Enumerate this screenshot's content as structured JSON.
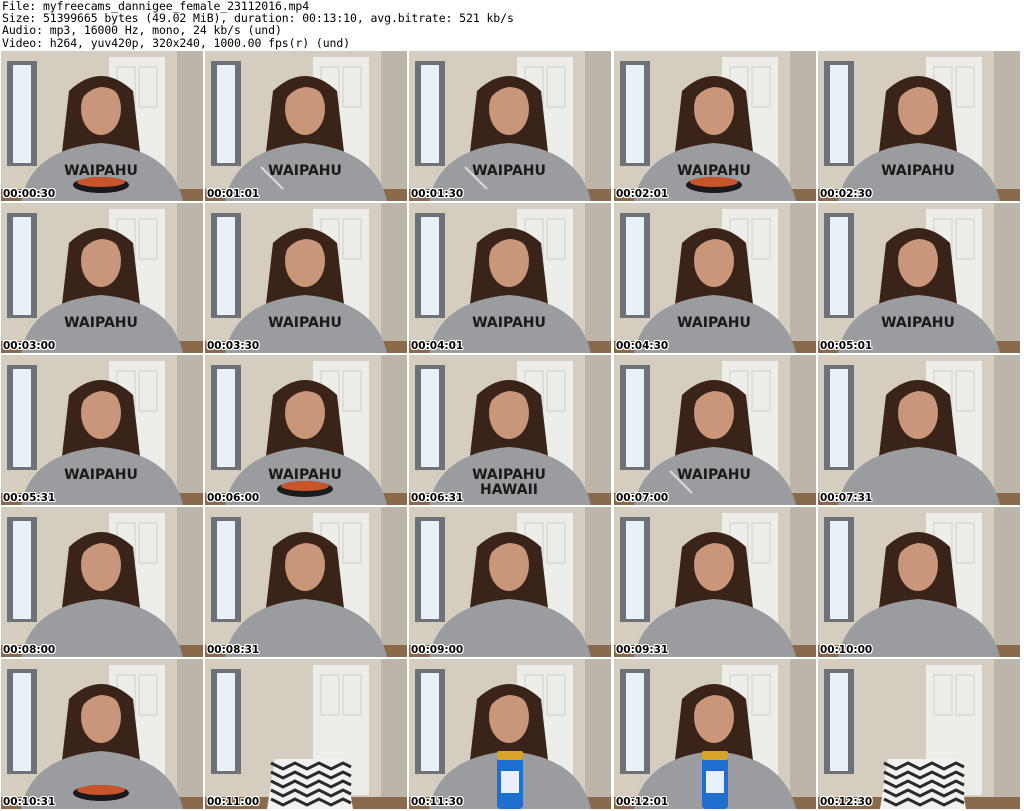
{
  "header": {
    "file_line": "File: myfreecams_dannigee_female_23112016.mp4",
    "size_line": "Size: 51399665 bytes (49.02 MiB), duration: 00:13:10, avg.bitrate: 521 kb/s",
    "audio_line": "Audio: mp3, 16000 Hz, mono, 24 kb/s (und)",
    "video_line": "Video: h264, yuv420p, 320x240, 1000.00 fps(r) (und)"
  },
  "grid": {
    "columns": 5,
    "rows": 5
  },
  "thumbnails": [
    {
      "timestamp": "00:00:30",
      "scene": "person",
      "hoodie": "WAIPAHU",
      "prop": "bowl"
    },
    {
      "timestamp": "00:01:01",
      "scene": "person",
      "hoodie": "WAIPAHU",
      "prop": "fork"
    },
    {
      "timestamp": "00:01:30",
      "scene": "person",
      "hoodie": "WAIPAHU",
      "prop": "fork"
    },
    {
      "timestamp": "00:02:01",
      "scene": "person",
      "hoodie": "WAIPAHU",
      "prop": "bowl"
    },
    {
      "timestamp": "00:02:30",
      "scene": "person",
      "hoodie": "WAIPAHU",
      "prop": "none"
    },
    {
      "timestamp": "00:03:00",
      "scene": "person",
      "hoodie": "WAIPAHU",
      "prop": "none"
    },
    {
      "timestamp": "00:03:30",
      "scene": "person",
      "hoodie": "WAIPAHU",
      "prop": "none"
    },
    {
      "timestamp": "00:04:01",
      "scene": "person",
      "hoodie": "WAIPAHU",
      "prop": "none"
    },
    {
      "timestamp": "00:04:30",
      "scene": "person",
      "hoodie": "WAIPAHU",
      "prop": "none"
    },
    {
      "timestamp": "00:05:01",
      "scene": "person",
      "hoodie": "WAIPAHU",
      "prop": "none"
    },
    {
      "timestamp": "00:05:31",
      "scene": "person",
      "hoodie": "WAIPAHU",
      "prop": "none"
    },
    {
      "timestamp": "00:06:00",
      "scene": "person",
      "hoodie": "WAIPAHU",
      "prop": "bowl"
    },
    {
      "timestamp": "00:06:31",
      "scene": "person",
      "hoodie": "WAIPAHU HAWAII",
      "prop": "none"
    },
    {
      "timestamp": "00:07:00",
      "scene": "person",
      "hoodie": "WAIPAHU",
      "prop": "fork"
    },
    {
      "timestamp": "00:07:31",
      "scene": "person",
      "hoodie": "",
      "prop": "none"
    },
    {
      "timestamp": "00:08:00",
      "scene": "person",
      "hoodie": "",
      "prop": "none"
    },
    {
      "timestamp": "00:08:31",
      "scene": "person",
      "hoodie": "",
      "prop": "none"
    },
    {
      "timestamp": "00:09:00",
      "scene": "person",
      "hoodie": "",
      "prop": "none"
    },
    {
      "timestamp": "00:09:31",
      "scene": "person",
      "hoodie": "",
      "prop": "none"
    },
    {
      "timestamp": "00:10:00",
      "scene": "person",
      "hoodie": "",
      "prop": "none"
    },
    {
      "timestamp": "00:10:31",
      "scene": "person",
      "hoodie": "",
      "prop": "bowl"
    },
    {
      "timestamp": "00:11:00",
      "scene": "chair",
      "hoodie": "",
      "prop": "none"
    },
    {
      "timestamp": "00:11:30",
      "scene": "person",
      "hoodie": "",
      "prop": "bottle"
    },
    {
      "timestamp": "00:12:01",
      "scene": "person",
      "hoodie": "",
      "prop": "bottle"
    },
    {
      "timestamp": "00:12:30",
      "scene": "chair",
      "hoodie": "",
      "prop": "none"
    }
  ],
  "colors": {
    "wall": "#d4cdc0",
    "door": "#ededea",
    "window": "#e8f0f8",
    "hair": "#3a241a",
    "skin": "#c9967a",
    "hoodie": "#9a9ca0",
    "hoodie_text": "#1a1a1a",
    "chair": "#2a2a2a",
    "floor": "#8a6a4a"
  }
}
